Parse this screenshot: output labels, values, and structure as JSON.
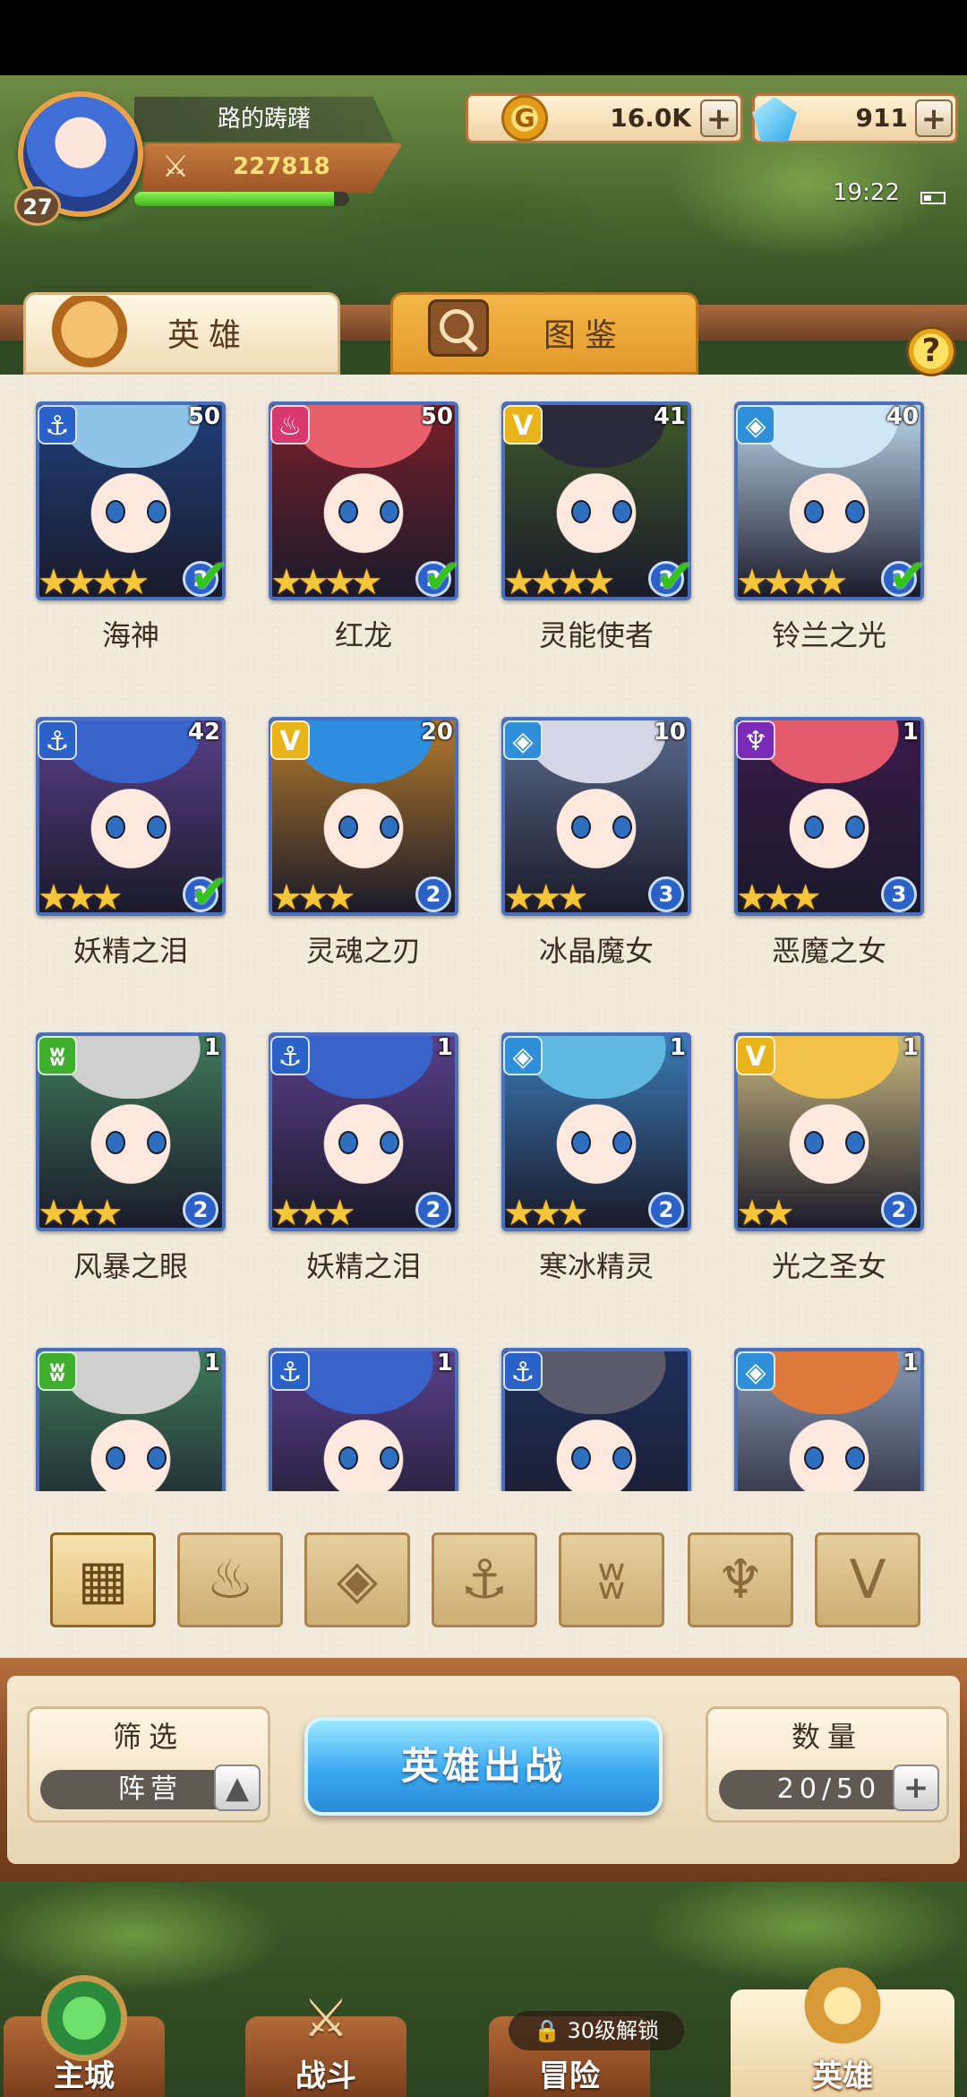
{
  "player": {
    "name": "路的踌躇",
    "level": "27",
    "power": "227818",
    "xp_fraction": 0.93
  },
  "currency": {
    "gold": "16.0K",
    "gems": "911"
  },
  "status": {
    "time": "19:22"
  },
  "tabs": {
    "heroes": "英雄",
    "codex": "图鉴"
  },
  "colors": {
    "faction_water": "#2b62c9",
    "faction_fire": "#d8386e",
    "faction_light": "#e8b41a",
    "faction_ice": "#2f8fd8",
    "faction_dark": "#7a2bb8",
    "faction_wind": "#3fae2f"
  },
  "heroes": [
    {
      "name": "海神",
      "level": "50",
      "stars": "★★★★",
      "rank": "2",
      "faction": "anchor",
      "deployed": true
    },
    {
      "name": "红龙",
      "level": "50",
      "stars": "★★★★",
      "rank": "2",
      "faction": "flame",
      "deployed": true
    },
    {
      "name": "灵能使者",
      "level": "41",
      "stars": "★★★★",
      "rank": "2",
      "faction": "wing",
      "deployed": true
    },
    {
      "name": "铃兰之光",
      "level": "40",
      "stars": "★★★★",
      "rank": "2",
      "faction": "crystal",
      "deployed": true
    },
    {
      "name": "妖精之泪",
      "level": "42",
      "stars": "★★★",
      "rank": "2",
      "faction": "anchor",
      "deployed": true
    },
    {
      "name": "灵魂之刃",
      "level": "20",
      "stars": "★★★",
      "rank": "2",
      "faction": "wing",
      "deployed": false
    },
    {
      "name": "冰晶魔女",
      "level": "10",
      "stars": "★★★",
      "rank": "3",
      "faction": "crystal",
      "deployed": false
    },
    {
      "name": "恶魔之女",
      "level": "1",
      "stars": "★★★",
      "rank": "3",
      "faction": "demon",
      "deployed": false
    },
    {
      "name": "风暴之眼",
      "level": "1",
      "stars": "★★★",
      "rank": "2",
      "faction": "beast",
      "deployed": false
    },
    {
      "name": "妖精之泪",
      "level": "1",
      "stars": "★★★",
      "rank": "2",
      "faction": "anchor",
      "deployed": false
    },
    {
      "name": "寒冰精灵",
      "level": "1",
      "stars": "★★★",
      "rank": "2",
      "faction": "crystal",
      "deployed": false
    },
    {
      "name": "光之圣女",
      "level": "1",
      "stars": "★★",
      "rank": "2",
      "faction": "wing",
      "deployed": false
    },
    {
      "name": "",
      "level": "1",
      "stars": "",
      "rank": "",
      "faction": "beast",
      "deployed": false
    },
    {
      "name": "",
      "level": "1",
      "stars": "",
      "rank": "",
      "faction": "anchor",
      "deployed": false
    },
    {
      "name": "",
      "level": "",
      "stars": "",
      "rank": "",
      "faction": "anchor",
      "deployed": false
    },
    {
      "name": "",
      "level": "1",
      "stars": "",
      "rank": "",
      "faction": "crystal",
      "deployed": false
    }
  ],
  "faction_filters": [
    "all-grid-icon",
    "flame-filter-icon",
    "crystal-filter-icon",
    "anchor-filter-icon",
    "beast-filter-icon",
    "demon-filter-icon",
    "wing-filter-icon"
  ],
  "bottom": {
    "filter_title": "筛选",
    "filter_value": "阵营",
    "deploy_label": "英雄出战",
    "count_title": "数量",
    "count_value": "20/50"
  },
  "nav": {
    "main_city": "主城",
    "battle": "战斗",
    "adventure": "冒险",
    "heroes": "英雄",
    "adventure_lock": "30级解锁"
  }
}
